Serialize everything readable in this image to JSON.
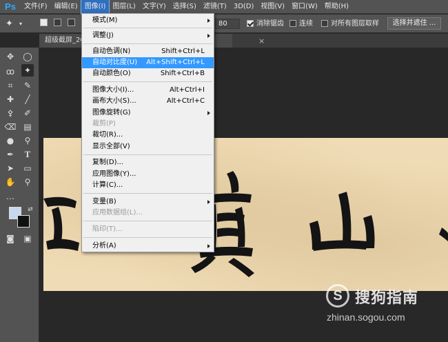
{
  "menubar": {
    "logo": "Ps",
    "items": [
      "文件(F)",
      "编辑(E)",
      "图像(I)",
      "图层(L)",
      "文字(Y)",
      "选择(S)",
      "滤镜(T)",
      "3D(D)",
      "视图(V)",
      "窗口(W)",
      "帮助(H)"
    ],
    "active_index": 2
  },
  "options": {
    "tolerance_value": "80",
    "antialias_label": "消除锯齿",
    "antialias_checked": true,
    "contiguous_label": "连续",
    "contiguous_checked": false,
    "sample_all_label": "对所有图层取样",
    "sample_all_checked": false,
    "select_mask_button": "选择并遮住 ..."
  },
  "document_tab": {
    "title": "超级截屏_20",
    "close_symbol": "×"
  },
  "image_menu": {
    "items": [
      {
        "label": "模式(M)",
        "shortcut": "",
        "submenu": true,
        "disabled": false,
        "highlighted": false
      },
      {
        "label": "调整(J)",
        "shortcut": "",
        "submenu": true,
        "disabled": false,
        "highlighted": false
      },
      {
        "label": "自动色调(N)",
        "shortcut": "Shift+Ctrl+L",
        "submenu": false,
        "disabled": false,
        "highlighted": false
      },
      {
        "label": "自动对比度(U)",
        "shortcut": "Alt+Shift+Ctrl+L",
        "submenu": false,
        "disabled": false,
        "highlighted": true
      },
      {
        "label": "自动颜色(O)",
        "shortcut": "Shift+Ctrl+B",
        "submenu": false,
        "disabled": false,
        "highlighted": false
      },
      {
        "label": "图像大小(I)...",
        "shortcut": "Alt+Ctrl+I",
        "submenu": false,
        "disabled": false,
        "highlighted": false
      },
      {
        "label": "画布大小(S)...",
        "shortcut": "Alt+Ctrl+C",
        "submenu": false,
        "disabled": false,
        "highlighted": false
      },
      {
        "label": "图像旋转(G)",
        "shortcut": "",
        "submenu": true,
        "disabled": false,
        "highlighted": false
      },
      {
        "label": "裁剪(P)",
        "shortcut": "",
        "submenu": false,
        "disabled": true,
        "highlighted": false
      },
      {
        "label": "裁切(R)...",
        "shortcut": "",
        "submenu": false,
        "disabled": false,
        "highlighted": false
      },
      {
        "label": "显示全部(V)",
        "shortcut": "",
        "submenu": false,
        "disabled": false,
        "highlighted": false
      },
      {
        "label": "复制(D)...",
        "shortcut": "",
        "submenu": false,
        "disabled": false,
        "highlighted": false
      },
      {
        "label": "应用图像(Y)...",
        "shortcut": "",
        "submenu": false,
        "disabled": false,
        "highlighted": false
      },
      {
        "label": "计算(C)...",
        "shortcut": "",
        "submenu": false,
        "disabled": false,
        "highlighted": false
      },
      {
        "label": "变量(B)",
        "shortcut": "",
        "submenu": true,
        "disabled": false,
        "highlighted": false
      },
      {
        "label": "应用数据组(L)...",
        "shortcut": "",
        "submenu": false,
        "disabled": true,
        "highlighted": false
      },
      {
        "label": "陷印(T)...",
        "shortcut": "",
        "submenu": false,
        "disabled": true,
        "highlighted": false
      },
      {
        "label": "分析(A)",
        "shortcut": "",
        "submenu": true,
        "disabled": false,
        "highlighted": false
      }
    ]
  },
  "colors": {
    "foreground": "#c8d6ee",
    "background": "#111111",
    "menu_highlight": "#3399ff",
    "active_menu": "#2f6fbf"
  },
  "watermark": {
    "logo_letter": "S",
    "name": "搜狗指南",
    "url": "zhinan.sogou.com"
  }
}
